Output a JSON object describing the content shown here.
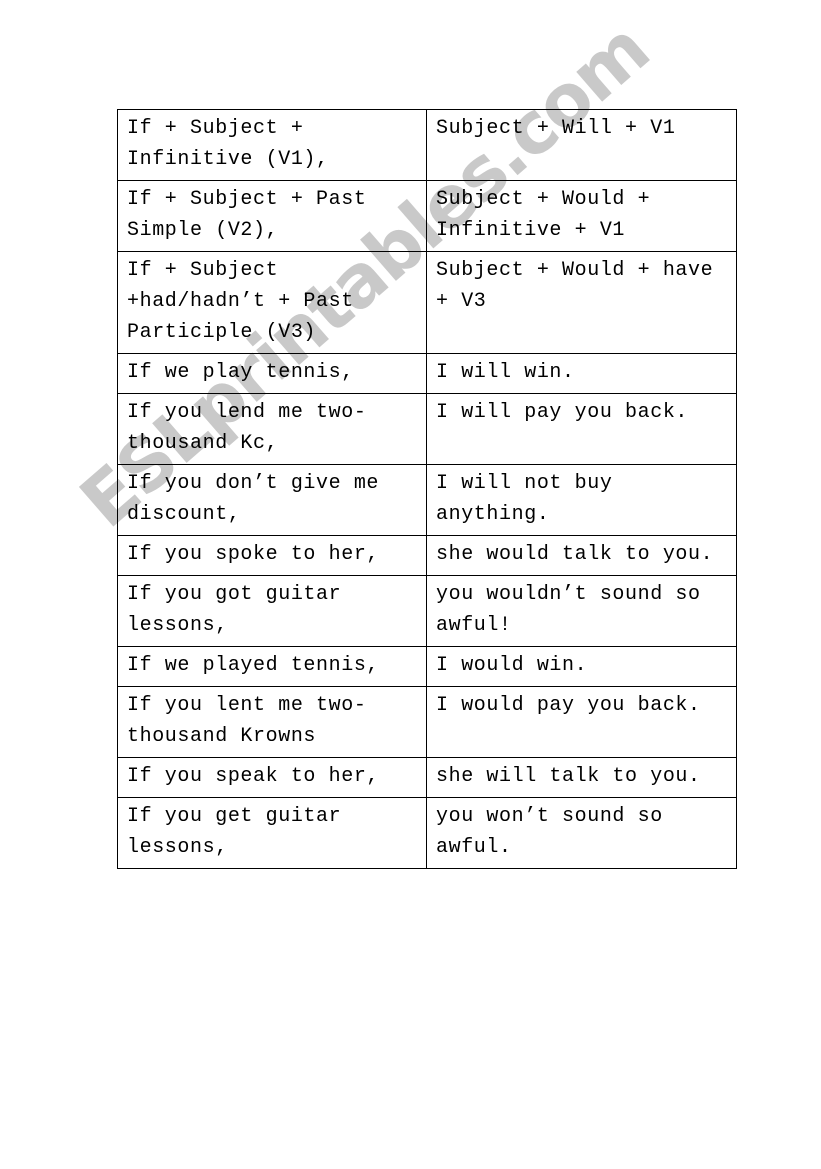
{
  "document": {
    "type": "worksheet-table",
    "watermark": "ESLprintables.com",
    "table": {
      "rows": [
        {
          "if_clause": "If + Subject + Infinitive (V1),",
          "result_clause": "Subject + Will + V1"
        },
        {
          "if_clause": "If + Subject + Past Simple (V2),",
          "result_clause": "Subject + Would + Infinitive + V1"
        },
        {
          "if_clause": "If + Subject +had/hadn’t + Past Participle (V3)",
          "result_clause": "Subject + Would + have + V3"
        },
        {
          "if_clause": "If we play tennis,",
          "result_clause": "I will win."
        },
        {
          "if_clause": "If you lend me two-thousand Kc,",
          "result_clause": "I will pay you back."
        },
        {
          "if_clause": "If you don’t give me discount,",
          "result_clause": "I will not buy anything."
        },
        {
          "if_clause": "If you spoke to her,",
          "result_clause": "she would talk to you."
        },
        {
          "if_clause": "If you got guitar lessons,",
          "result_clause": "you wouldn’t sound so awful!"
        },
        {
          "if_clause": "If we played tennis,",
          "result_clause": "I would win."
        },
        {
          "if_clause": "If you lent me two-thousand Krowns",
          "result_clause": "I would pay you back."
        },
        {
          "if_clause": "If you speak to her,",
          "result_clause": "she will talk to you."
        },
        {
          "if_clause": "If you get guitar lessons,",
          "result_clause": "you won’t sound so awful."
        }
      ]
    }
  }
}
